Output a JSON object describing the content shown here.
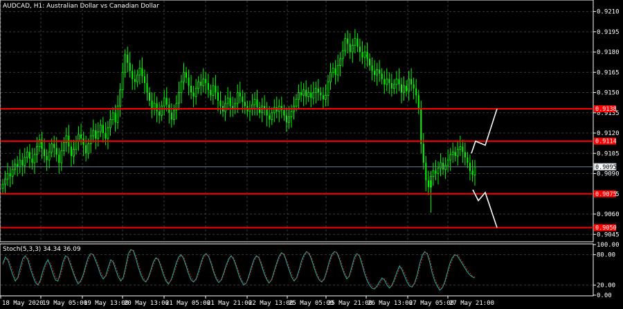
{
  "chart_data": [
    {
      "type": "candlestick",
      "symbol": "AUDCAD",
      "timeframe": "H1",
      "title": "AUDCAD, H1:  Australian Dollar vs Canadian Dollar",
      "ylim": [
        0.904,
        0.9218
      ],
      "y_ticks": [
        "0.9210",
        "0.9195",
        "0.9180",
        "0.9165",
        "0.9150",
        "0.9135",
        "0.9120",
        "0.9105",
        "0.9090",
        "0.9075",
        "0.9060",
        "0.9045"
      ],
      "x_labels": [
        "18 May 2020",
        "19 May 05:00",
        "19 May 13:00",
        "20 May 13:00",
        "21 May 05:00",
        "21 May 21:00",
        "22 May 13:00",
        "25 May 05:00",
        "25 May 21:00",
        "26 May 13:00",
        "27 May 05:00",
        "27 May 21:00"
      ],
      "current_price": "0.9095",
      "horizontal_levels": [
        {
          "value": 0.9138,
          "label": "0.9138"
        },
        {
          "value": 0.9114,
          "label": "0.9114"
        },
        {
          "value": 0.9075,
          "label": "0.9075"
        },
        {
          "value": 0.905,
          "label": "0.9050"
        }
      ],
      "colors": {
        "bull": "#00ff00",
        "bear": "#00ff00",
        "level": "#ff0000",
        "grid": "#3a3a3a",
        "text": "#ffffff",
        "projection": "#ffffff",
        "bid_line": "#708090"
      },
      "candles_close": [
        0.9082,
        0.9086,
        0.909,
        0.9088,
        0.9093,
        0.9097,
        0.9095,
        0.91,
        0.9096,
        0.9102,
        0.9106,
        0.9101,
        0.9098,
        0.9104,
        0.911,
        0.9115,
        0.9108,
        0.9103,
        0.91,
        0.9106,
        0.9112,
        0.9109,
        0.9104,
        0.9098,
        0.9107,
        0.9113,
        0.9118,
        0.911,
        0.9103,
        0.9108,
        0.9114,
        0.9119,
        0.9116,
        0.9111,
        0.9105,
        0.9112,
        0.9118,
        0.9122,
        0.9116,
        0.9121,
        0.9126,
        0.912,
        0.9116,
        0.9124,
        0.913,
        0.9135,
        0.9128,
        0.914,
        0.9152,
        0.9165,
        0.9178,
        0.9172,
        0.9166,
        0.916,
        0.9158,
        0.9163,
        0.9168,
        0.9162,
        0.9157,
        0.915,
        0.9144,
        0.9138,
        0.9142,
        0.9136,
        0.9133,
        0.914,
        0.9146,
        0.9141,
        0.9135,
        0.913,
        0.9137,
        0.9142,
        0.915,
        0.9158,
        0.9165,
        0.9161,
        0.9155,
        0.915,
        0.9147,
        0.9153,
        0.9158,
        0.9155,
        0.916,
        0.9157,
        0.9152,
        0.9148,
        0.9155,
        0.915,
        0.9144,
        0.914,
        0.9136,
        0.9142,
        0.9146,
        0.914,
        0.9138,
        0.9142,
        0.915,
        0.9147,
        0.9143,
        0.914,
        0.9136,
        0.9138,
        0.9141,
        0.9145,
        0.9139,
        0.9135,
        0.914,
        0.9138,
        0.9133,
        0.913,
        0.9135,
        0.9139,
        0.9136,
        0.914,
        0.9137,
        0.9133,
        0.9128,
        0.9132,
        0.9136,
        0.914,
        0.9145,
        0.915,
        0.9148,
        0.9152,
        0.9147,
        0.915,
        0.9146,
        0.915,
        0.9153,
        0.915,
        0.9148,
        0.9145,
        0.9148,
        0.9158,
        0.9165,
        0.9168,
        0.9163,
        0.917,
        0.9175,
        0.9181,
        0.919,
        0.9186,
        0.918,
        0.9185,
        0.919,
        0.9184,
        0.918,
        0.9176,
        0.918,
        0.9175,
        0.917,
        0.9166,
        0.9163,
        0.9167,
        0.9164,
        0.916,
        0.9156,
        0.916,
        0.9157,
        0.9153,
        0.9156,
        0.916,
        0.9156,
        0.915,
        0.9155,
        0.9151,
        0.916,
        0.9156,
        0.9153,
        0.9148,
        0.9138,
        0.9112,
        0.9098,
        0.9085,
        0.908,
        0.9088,
        0.9092,
        0.909,
        0.9094,
        0.9098,
        0.9093,
        0.9096,
        0.91,
        0.9104,
        0.9106,
        0.9103,
        0.9108,
        0.911,
        0.9106,
        0.9102,
        0.9098,
        0.9092,
        0.9089,
        0.9095
      ],
      "projection_path": [
        [
          0.9075,
          0.9075
        ],
        [
          0.907,
          0.9076
        ],
        [
          0.905,
          0.905
        ]
      ],
      "projection_up": [
        [
          0.9114,
          0.9114
        ],
        [
          0.912,
          0.9111
        ],
        [
          0.9138,
          0.9138
        ]
      ]
    },
    {
      "type": "line",
      "title": "Stoch(5,3,3) 34.34 36.09",
      "indicator": "Stoch(5,3,3)",
      "values_text": "34.34 36.09",
      "ylim": [
        0,
        100
      ],
      "y_ticks": [
        "100.00",
        "80.00",
        "20.00",
        "0.00"
      ],
      "levels": [
        80,
        20
      ],
      "series": [
        {
          "color": "#20b2aa",
          "values": [
            62,
            75,
            70,
            55,
            40,
            28,
            35,
            55,
            72,
            78,
            70,
            52,
            38,
            25,
            20,
            30,
            48,
            62,
            70,
            58,
            42,
            30,
            28,
            45,
            66,
            78,
            74,
            60,
            45,
            32,
            22,
            28,
            40,
            58,
            74,
            82,
            80,
            68,
            55,
            40,
            32,
            38,
            55,
            70,
            65,
            50,
            36,
            28,
            35,
            58,
            82,
            90,
            88,
            72,
            55,
            40,
            30,
            26,
            35,
            50,
            66,
            74,
            70,
            56,
            40,
            28,
            22,
            30,
            45,
            62,
            75,
            80,
            72,
            58,
            42,
            30,
            26,
            32,
            48,
            65,
            78,
            82,
            76,
            62,
            45,
            32,
            25,
            30,
            44,
            60,
            72,
            78,
            70,
            56,
            40,
            28,
            20,
            24,
            38,
            55,
            70,
            78,
            74,
            60,
            44,
            32,
            24,
            30,
            46,
            62,
            76,
            84,
            80,
            66,
            50,
            36,
            28,
            34,
            50,
            68,
            80,
            86,
            82,
            70,
            54,
            40,
            30,
            26,
            32,
            48,
            66,
            80,
            86,
            84,
            72,
            56,
            42,
            32,
            38,
            56,
            74,
            82,
            78,
            62,
            44,
            30,
            20,
            14,
            12,
            18,
            26,
            34,
            30,
            20,
            14,
            20,
            32,
            46,
            58,
            50,
            38,
            26,
            18,
            16,
            24,
            40,
            62,
            78,
            86,
            82,
            66,
            44,
            28,
            18,
            10,
            14,
            26,
            44,
            62,
            74,
            80,
            78,
            70,
            62,
            54,
            46,
            40,
            36,
            34
          ]
        },
        {
          "color": "#cc2222",
          "dash": true,
          "values": [
            60,
            70,
            72,
            62,
            48,
            34,
            32,
            46,
            64,
            76,
            74,
            60,
            44,
            30,
            22,
            26,
            40,
            56,
            66,
            64,
            50,
            36,
            30,
            38,
            58,
            74,
            76,
            66,
            50,
            36,
            26,
            26,
            36,
            52,
            68,
            80,
            82,
            72,
            60,
            46,
            36,
            36,
            48,
            64,
            68,
            56,
            42,
            32,
            32,
            50,
            74,
            88,
            90,
            78,
            62,
            46,
            34,
            28,
            32,
            46,
            60,
            72,
            72,
            60,
            46,
            32,
            24,
            28,
            40,
            56,
            70,
            78,
            76,
            62,
            48,
            36,
            28,
            30,
            42,
            60,
            74,
            80,
            78,
            66,
            50,
            36,
            28,
            28,
            40,
            56,
            68,
            76,
            74,
            60,
            46,
            32,
            24,
            24,
            34,
            50,
            66,
            76,
            76,
            64,
            50,
            36,
            28,
            28,
            42,
            58,
            72,
            82,
            82,
            70,
            56,
            42,
            32,
            32,
            46,
            62,
            76,
            84,
            84,
            74,
            60,
            44,
            34,
            28,
            30,
            44,
            60,
            76,
            84,
            86,
            76,
            62,
            46,
            36,
            36,
            50,
            68,
            80,
            80,
            68,
            50,
            36,
            24,
            18,
            14,
            16,
            22,
            30,
            32,
            26,
            18,
            18,
            28,
            40,
            54,
            54,
            44,
            32,
            22,
            18,
            22,
            34,
            54,
            72,
            84,
            84,
            72,
            52,
            34,
            22,
            14,
            14,
            22,
            38,
            56,
            70,
            78,
            80,
            74,
            66,
            58,
            50,
            44,
            38,
            36
          ]
        }
      ]
    }
  ]
}
